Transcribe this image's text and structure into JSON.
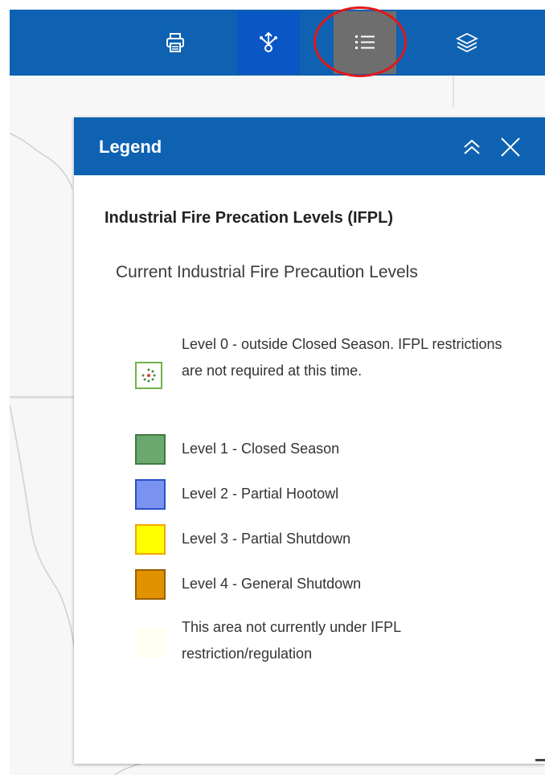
{
  "toolbar": {
    "buttons": [
      {
        "icon": "printer-icon",
        "state": "normal"
      },
      {
        "icon": "share-icon",
        "state": "active"
      },
      {
        "icon": "legend-list-icon",
        "state": "selected"
      },
      {
        "icon": "layers-icon",
        "state": "normal"
      }
    ],
    "highlight_color": "#e01818"
  },
  "legend_panel": {
    "title": "Legend",
    "collapse_icon": "double-chevron-up-icon",
    "close_icon": "close-icon",
    "layer_title": "Industrial Fire Precation Levels (IFPL)",
    "layer_subtitle": "Current Industrial Fire Precaution Levels",
    "items": [
      {
        "label": "Level 0 - outside Closed Season. IFPL restrictions are not required at this time.",
        "fill": "#ffffff",
        "border": "#70b04a",
        "icon": "dotted-sun-icon"
      },
      {
        "label": "Level 1 - Closed Season",
        "fill": "#6aa86d",
        "border": "#3f7a42"
      },
      {
        "label": "Level 2 - Partial Hootowl",
        "fill": "#7b93f0",
        "border": "#2a4fc9"
      },
      {
        "label": "Level 3 - Partial Shutdown",
        "fill": "#ffff00",
        "border": "#f0a800"
      },
      {
        "label": "Level 4 - General Shutdown",
        "fill": "#e09200",
        "border": "#9a6000"
      },
      {
        "label": "This area not currently under IFPL restriction/regulation",
        "fill": "#fffff2",
        "border": "#fffff2"
      }
    ]
  },
  "colors": {
    "header_blue": "#0e62b1",
    "selected_gray": "#6e6e6e"
  }
}
